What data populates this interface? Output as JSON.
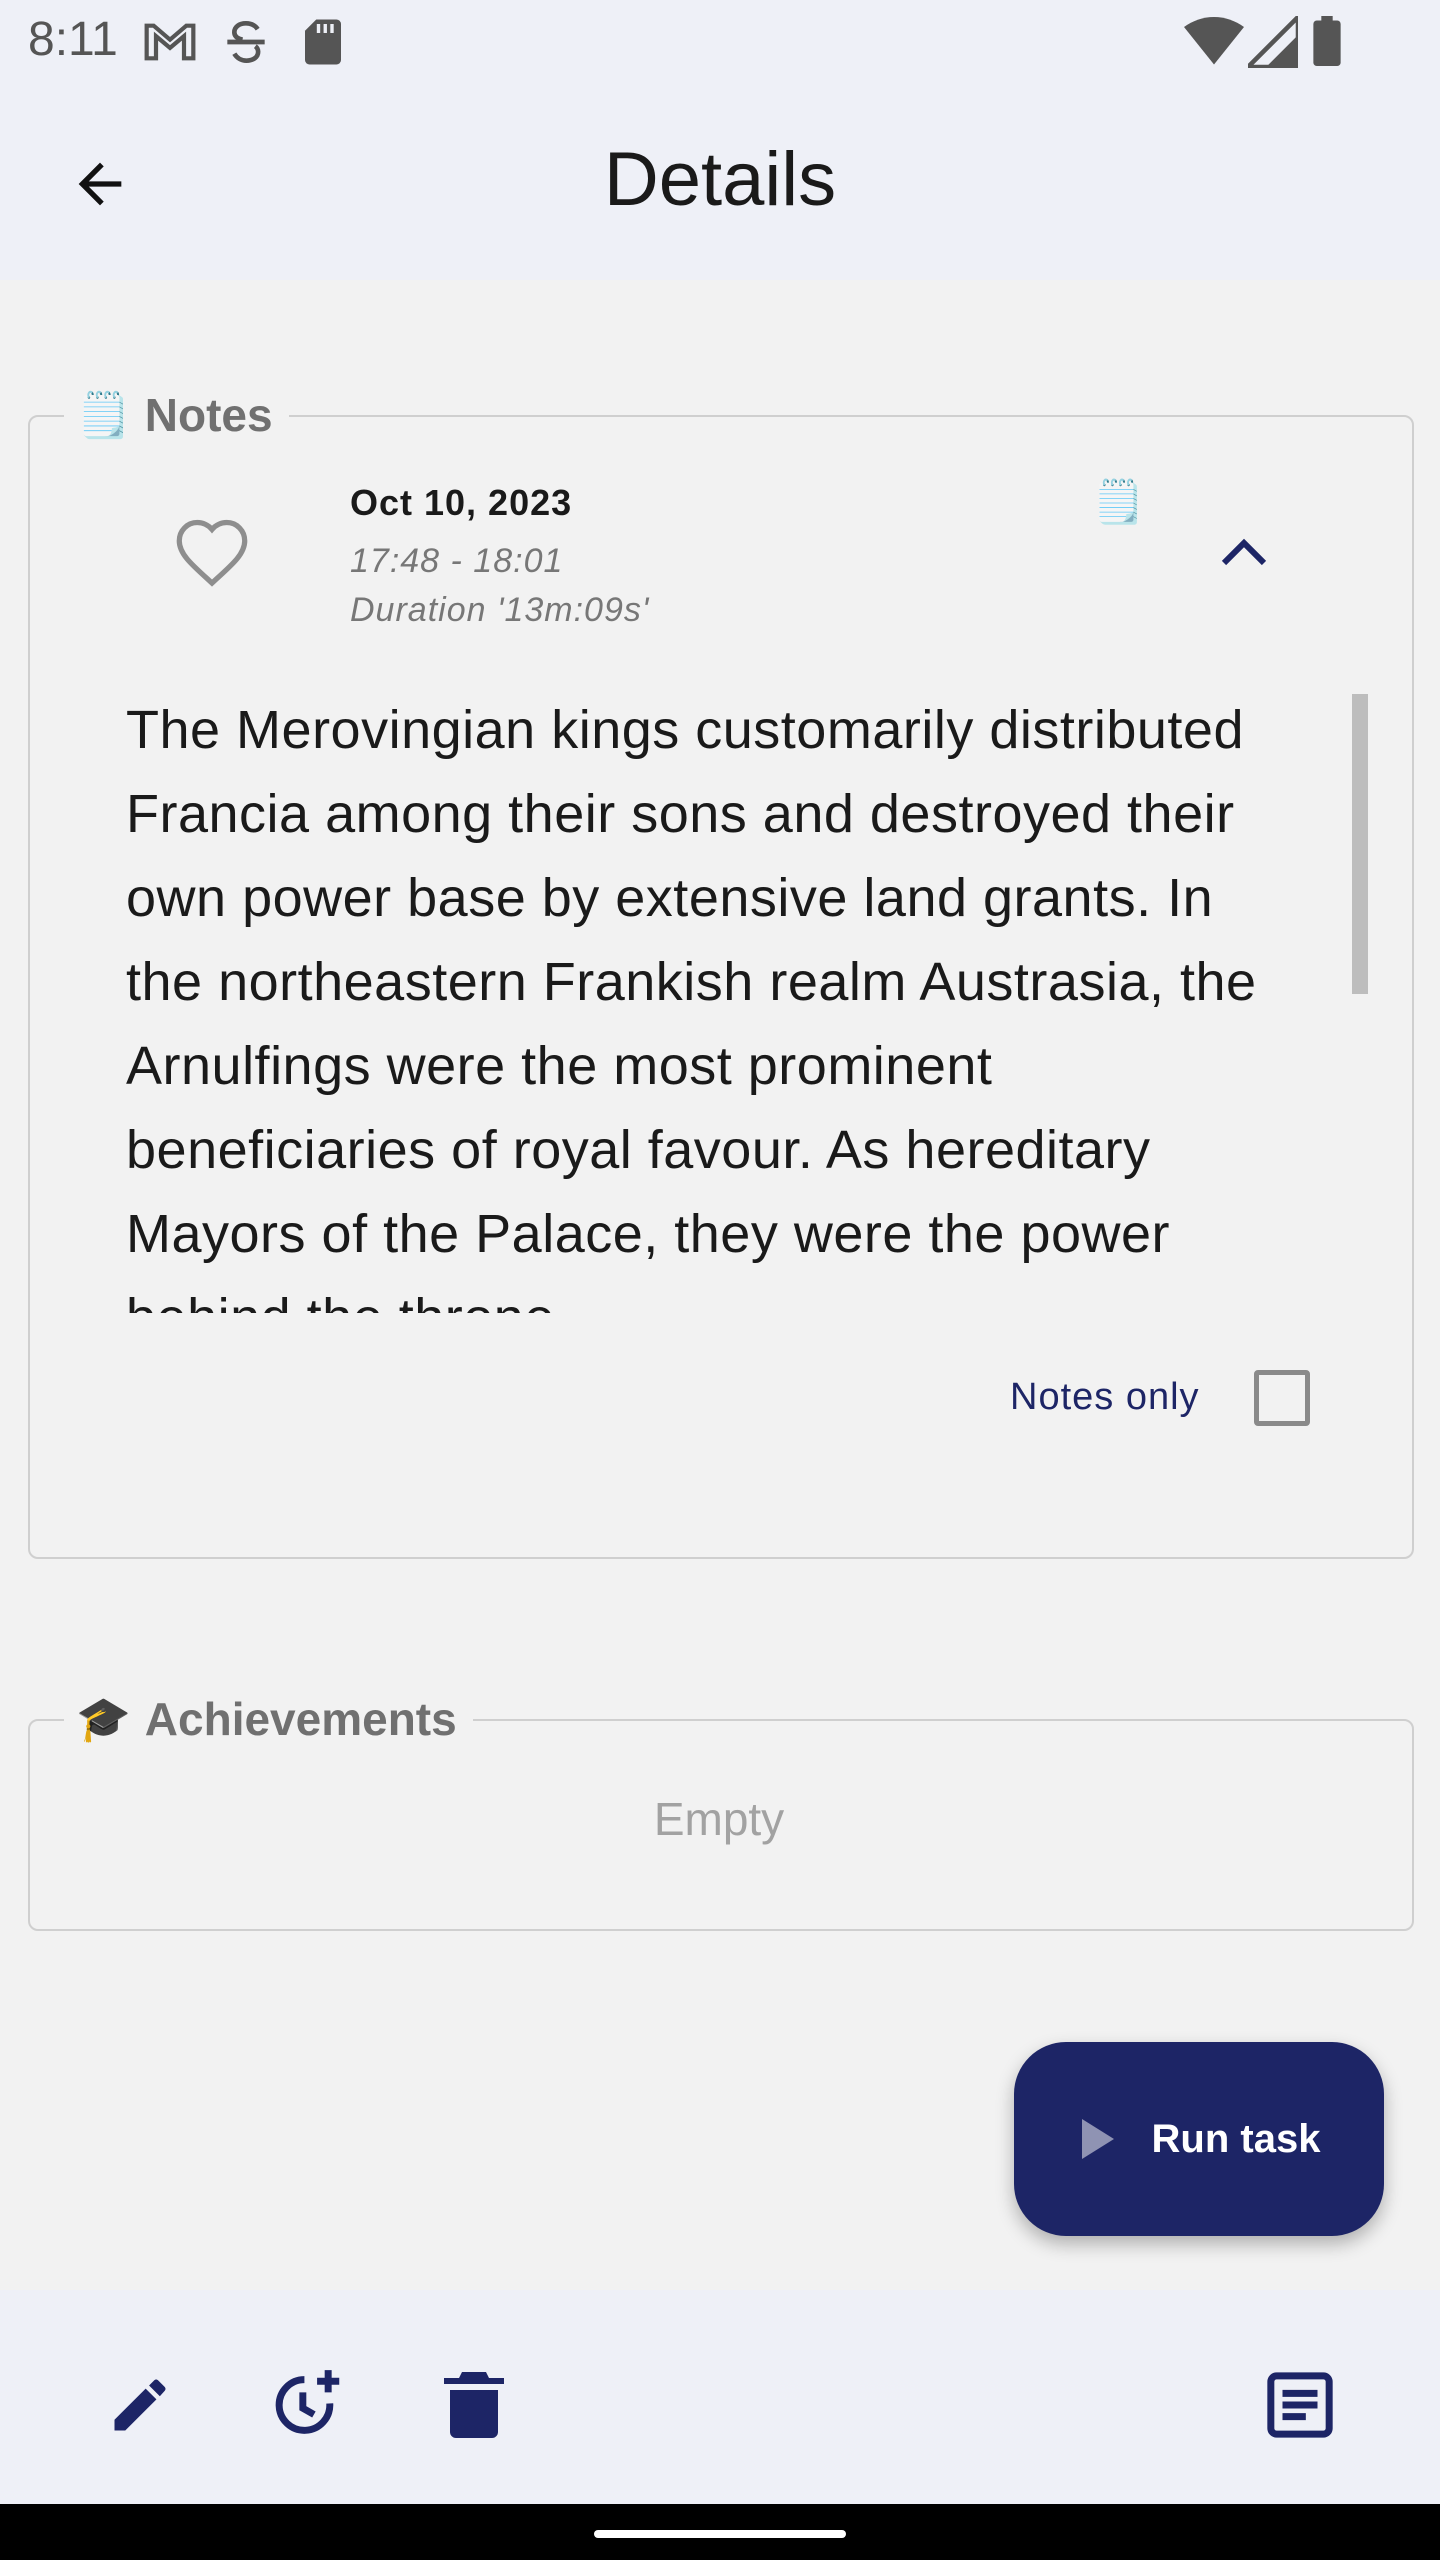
{
  "status_bar": {
    "time": "8:11",
    "left_icons": [
      "gmail-icon",
      "strikethrough-s-icon",
      "sd-card-icon"
    ],
    "right_icons": [
      "wifi-icon",
      "signal-icon",
      "battery-icon"
    ]
  },
  "app_bar": {
    "title": "Details",
    "back_icon": "arrow-back-icon"
  },
  "notes_section": {
    "legend_emoji": "🗒️",
    "legend": "Notes",
    "entry": {
      "favorite_icon": "heart-outline-icon",
      "date": "Oct 10, 2023",
      "time_range": "17:48 - 18:01",
      "duration": "Duration '13m:09s'",
      "note_icon_emoji": "🗒️",
      "collapse_icon": "chevron-up-icon",
      "text": "The Merovingian kings customarily distributed Francia among their sons and destroyed their own power base by extensive land grants. In the northeastern Frankish realm Austrasia, the Arnulfings were the most prominent beneficiaries of royal favour. As hereditary Mayors of the Palace, they were the power behind the throne"
    },
    "notes_only_label": "Notes only",
    "notes_only_checked": false
  },
  "achievements_section": {
    "legend_emoji": "🎓",
    "legend": "Achievements",
    "empty_text": "Empty"
  },
  "fab": {
    "icon": "play-icon",
    "label": "Run task"
  },
  "bottom_bar": {
    "actions": [
      "edit-icon",
      "add-reminder-icon",
      "delete-icon",
      "notes-list-icon"
    ]
  },
  "colors": {
    "primary": "#1d2566",
    "surface": "#eef0f7",
    "background": "#f2f2f2"
  }
}
